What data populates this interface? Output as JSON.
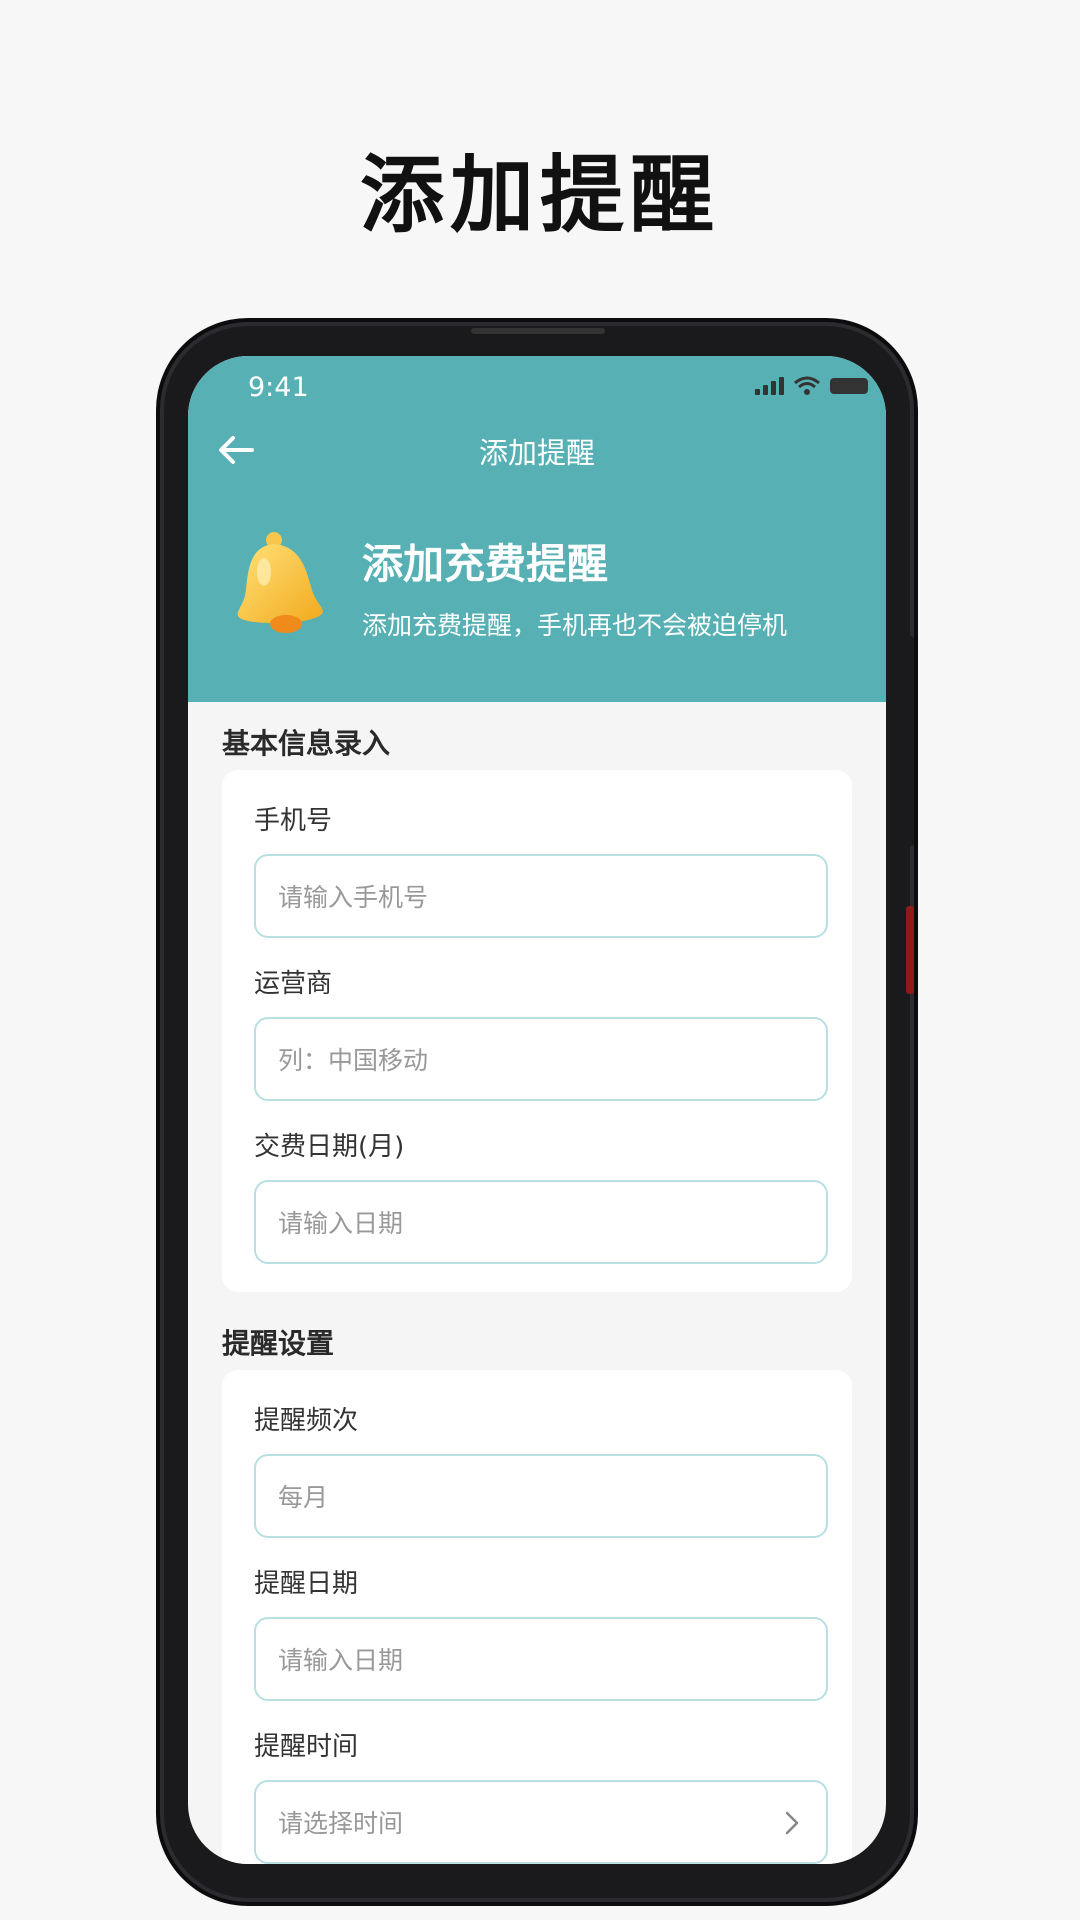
{
  "promo": {
    "title": "添加提醒"
  },
  "status": {
    "time": "9:41"
  },
  "nav": {
    "title": "添加提醒"
  },
  "banner": {
    "title": "添加充费提醒",
    "subtitle": "添加充费提醒，手机再也不会被迫停机"
  },
  "basic": {
    "section_title": "基本信息录入",
    "phone_label": "手机号",
    "phone_placeholder": "请输入手机号",
    "carrier_label": "运营商",
    "carrier_placeholder": "列：中国移动",
    "pay_date_label": "交费日期(月)",
    "pay_date_placeholder": "请输入日期"
  },
  "reminder": {
    "section_title": "提醒设置",
    "freq_label": "提醒频次",
    "freq_value": "每月",
    "date_label": "提醒日期",
    "date_placeholder": "请输入日期",
    "time_label": "提醒时间",
    "time_placeholder": "请选择时间"
  },
  "colors": {
    "header": "#56b0b4",
    "input_border": "#b9dfe2"
  }
}
